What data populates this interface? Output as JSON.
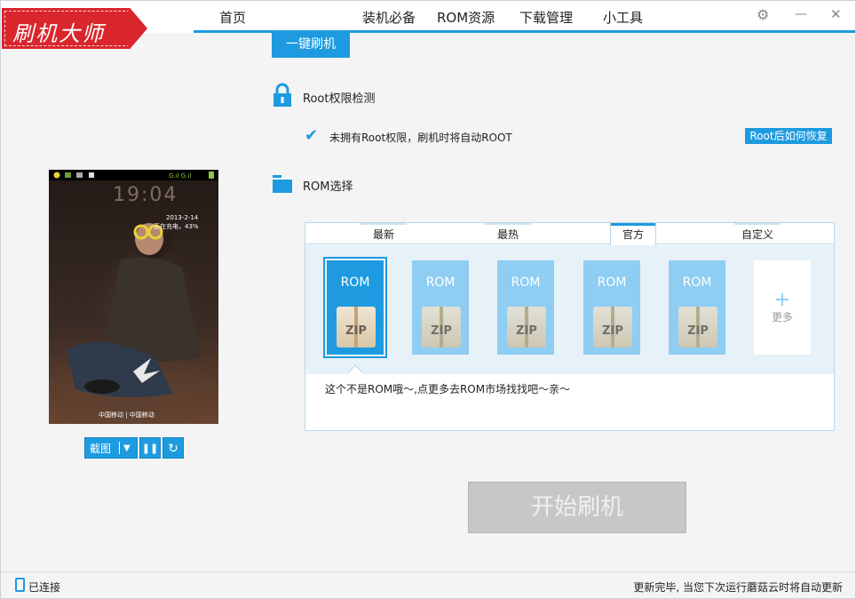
{
  "app": {
    "logo_text": "刷机大师"
  },
  "nav": {
    "home": "首页",
    "essentials": "装机必备",
    "rom": "ROM资源",
    "downloads": "下载管理",
    "tools": "小工具"
  },
  "window_controls": {
    "settings": "⚙",
    "minimize": "—",
    "close": "✕"
  },
  "subtab": {
    "label": "一键刷机"
  },
  "phone": {
    "clock": "19:04",
    "date": "2013-2-14",
    "charging": "正在充电，43%",
    "carrier": "中国移动 | 中国移动"
  },
  "phone_controls": {
    "screenshot": "截图",
    "dropdown": "▼",
    "pause": "⏸",
    "refresh": "↻"
  },
  "root": {
    "title": "Root权限检测",
    "status": "未拥有Root权限，刷机时将自动ROOT",
    "help_link": "Root后如何恢复"
  },
  "rom": {
    "title": "ROM选择",
    "tabs": [
      "最新",
      "最热",
      "官方",
      "自定义"
    ],
    "active_tab": "官方",
    "card_label": "ROM",
    "card_zip": "ZIP",
    "more": "更多",
    "message": "这个不是ROM哦～,点更多去ROM市场找找吧～亲～"
  },
  "start_button": "开始刷机",
  "status": {
    "connection": "已连接",
    "update": "更新完毕, 当您下次运行蘑菇云时将自动更新"
  },
  "colors": {
    "accent": "#1e9be0",
    "logo": "#d9262d"
  }
}
